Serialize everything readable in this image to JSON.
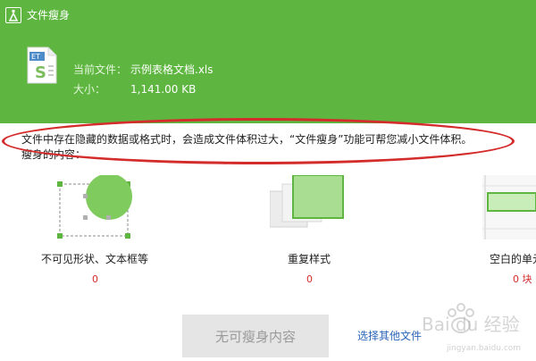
{
  "header": {
    "title": "文件瘦身",
    "file_label": "当前文件：",
    "file_name": "示例表格文档.xls",
    "size_label": "大小：",
    "size_value": "1,141.00 KB",
    "file_icon_text": "ET",
    "bg_color": "#5eb640"
  },
  "description": {
    "line1": "文件中存在隐藏的数据或格式时，会造成文件体积过大，“文件瘦身”功能可帮您减小文件体积。",
    "line2": "瘦身的内容："
  },
  "items": [
    {
      "label": "不可见形状、文本框等",
      "count": "0",
      "icon": "hidden-shapes-icon"
    },
    {
      "label": "重复样式",
      "count": "0",
      "icon": "duplicate-styles-icon"
    },
    {
      "label": "空白的单元",
      "count": "0 块",
      "icon": "blank-cells-icon"
    }
  ],
  "actions": {
    "primary_label": "无可瘦身内容",
    "link_label": "选择其他文件"
  },
  "watermark": {
    "text": "Bai du 经验",
    "url_text": "jingyan.baidu.com"
  },
  "colors": {
    "accent": "#5eb640",
    "count": "#d42b2b",
    "link": "#2a64b8",
    "highlight": "#d42b2b"
  }
}
